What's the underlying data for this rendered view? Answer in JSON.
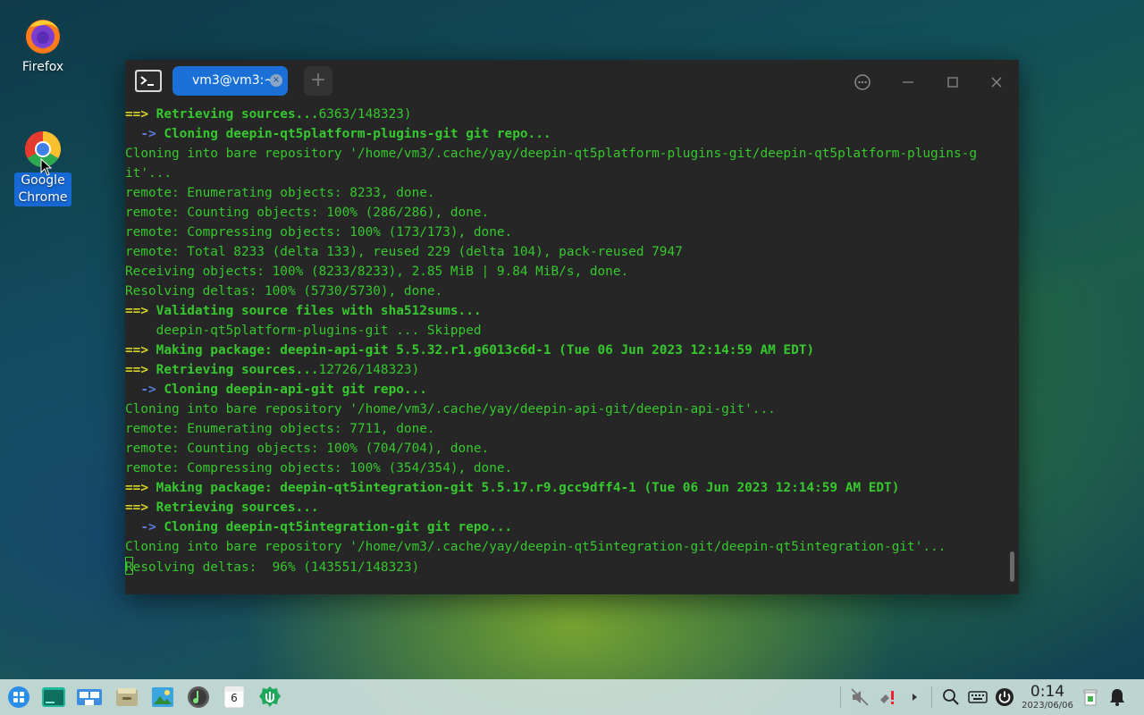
{
  "desktop": {
    "icons": [
      {
        "label": "Firefox"
      },
      {
        "label": "Google Chrome"
      }
    ]
  },
  "terminal": {
    "tab_title": "vm3@vm3:~",
    "tab_close": "×",
    "new_tab": "+",
    "lines": [
      {
        "arrow": "==> ",
        "bold": "Retrieving sources...",
        "rest": "6363/148323)"
      },
      {
        "indent": "  ",
        "arrow": "-> ",
        "bold": "Cloning deepin-qt5platform-plugins-git git repo..."
      },
      {
        "text": "Cloning into bare repository '/home/vm3/.cache/yay/deepin-qt5platform-plugins-git/deepin-qt5platform-plugins-g"
      },
      {
        "text": "it'..."
      },
      {
        "text": "remote: Enumerating objects: 8233, done."
      },
      {
        "text": "remote: Counting objects: 100% (286/286), done."
      },
      {
        "text": "remote: Compressing objects: 100% (173/173), done."
      },
      {
        "text": "remote: Total 8233 (delta 133), reused 229 (delta 104), pack-reused 7947"
      },
      {
        "text": "Receiving objects: 100% (8233/8233), 2.85 MiB | 9.84 MiB/s, done."
      },
      {
        "text": "Resolving deltas: 100% (5730/5730), done."
      },
      {
        "arrow": "==> ",
        "bold": "Validating source files with sha512sums..."
      },
      {
        "text": "    deepin-qt5platform-plugins-git ... Skipped"
      },
      {
        "arrow": "==> ",
        "bold": "Making package: deepin-api-git 5.5.32.r1.g6013c6d-1 (Tue 06 Jun 2023 12:14:59 AM EDT)"
      },
      {
        "arrow": "==> ",
        "bold": "Retrieving sources...",
        "rest": "12726/148323)"
      },
      {
        "indent": "  ",
        "arrow": "-> ",
        "bold": "Cloning deepin-api-git git repo..."
      },
      {
        "text": "Cloning into bare repository '/home/vm3/.cache/yay/deepin-api-git/deepin-api-git'..."
      },
      {
        "text": "remote: Enumerating objects: 7711, done."
      },
      {
        "text": "remote: Counting objects: 100% (704/704), done."
      },
      {
        "text": "remote: Compressing objects: 100% (354/354), done."
      },
      {
        "arrow": "==> ",
        "bold": "Making package: deepin-qt5integration-git 5.5.17.r9.gcc9dff4-1 (Tue 06 Jun 2023 12:14:59 AM EDT)"
      },
      {
        "arrow": "==> ",
        "bold": "Retrieving sources..."
      },
      {
        "indent": "  ",
        "arrow": "-> ",
        "bold": "Cloning deepin-qt5integration-git git repo..."
      },
      {
        "text": "Cloning into bare repository '/home/vm3/.cache/yay/deepin-qt5integration-git/deepin-qt5integration-git'..."
      },
      {
        "text": "Resolving deltas:  96% (143551/148323)",
        "cursor": true
      }
    ]
  },
  "taskbar": {
    "apps": [
      "launcher-icon",
      "terminal-icon",
      "multitask-view-icon",
      "file-manager-icon",
      "image-viewer-icon",
      "music-icon",
      "calendar-icon",
      "app-store-icon"
    ],
    "calendar_day": "6",
    "clock_time": "0:14",
    "clock_date": "2023/06/06"
  },
  "colors": {
    "terminal_bg": "#262626",
    "terminal_text": "#36c82e",
    "prompt_arrow": "#d6d322",
    "sub_arrow": "#5b7be0",
    "tab_active": "#1a70d6"
  }
}
